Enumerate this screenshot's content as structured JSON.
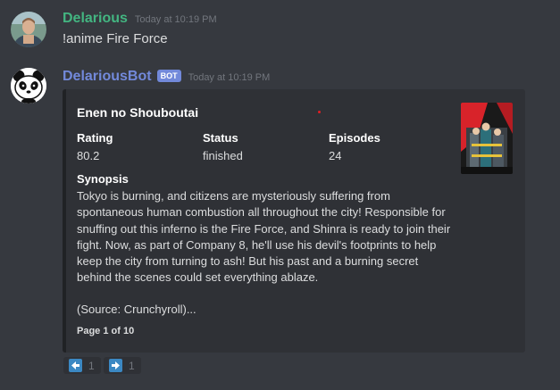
{
  "messages": [
    {
      "author": "Delarious",
      "author_color": "#43b581",
      "timestamp": "Today at 10:19 PM",
      "content": "!anime Fire Force"
    },
    {
      "author": "DelariousBot",
      "author_color": "#7289da",
      "bot_tag": "BOT",
      "timestamp": "Today at 10:19 PM",
      "embed": {
        "title": "Enen no Shouboutai",
        "fields": [
          {
            "name": "Rating",
            "value": "80.2"
          },
          {
            "name": "Status",
            "value": "finished"
          },
          {
            "name": "Episodes",
            "value": "24"
          }
        ],
        "synopsis_label": "Synopsis",
        "synopsis": "Tokyo is burning, and citizens are mysteriously suffering from spontaneous human combustion all throughout the city! Responsible for snuffing out this inferno is the Fire Force, and Shinra is ready to join their fight. Now, as part of Company 8, he'll use his devil's footprints to help keep the city from turning to ash! But his past and a burning secret behind the scenes could set everything ablaze.",
        "source": "(Source: Crunchyroll)...",
        "footer": "Page 1 of 10",
        "thumbnail_icon": "anime-cover-image"
      },
      "reactions": [
        {
          "emoji": "arrow-left-icon",
          "count": "1"
        },
        {
          "emoji": "arrow-right-icon",
          "count": "1"
        }
      ]
    }
  ],
  "colors": {
    "background": "#36393f",
    "embed_bg": "#2f3136",
    "text": "#dcddde",
    "muted": "#72767d",
    "blurple": "#7289da",
    "green": "#43b581"
  }
}
